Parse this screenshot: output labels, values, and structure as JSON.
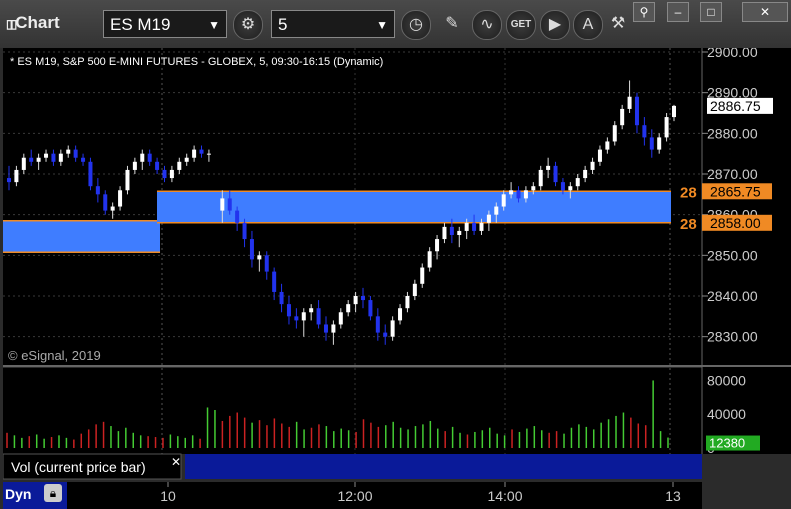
{
  "window": {
    "title": "Chart",
    "symbol": "ES M19",
    "interval": "5",
    "toolbar_icons": [
      "settings-icon",
      "clock-icon",
      "pencil-icon",
      "line-study-icon",
      "get-icon",
      "play-icon",
      "alert-icon",
      "tools-icon"
    ]
  },
  "chart_data": {
    "type": "candlestick",
    "title": "* ES M19, S&P 500 E-MINI FUTURES - GLOBEX, 5, 09:30-16:15 (Dynamic)",
    "watermark": "© eSignal, 2019",
    "x_tick_labels": [
      "10",
      "12:00",
      "14:00",
      "13"
    ],
    "price_axis": {
      "min": 2825,
      "max": 2900,
      "ticks": [
        2900,
        2890,
        2880,
        2870,
        2860,
        2850,
        2840,
        2830
      ],
      "tick_labels": [
        "2900.00",
        "2890.00",
        "2880.00",
        "2870.00",
        "2860.00",
        "2850.00",
        "2840.00",
        "2830.00"
      ]
    },
    "last_price": 2886.75,
    "last_price_label": "2886.75",
    "zones": [
      {
        "name": "prior-day-zone",
        "low": 2850.75,
        "high": 2858.5
      },
      {
        "name": "current-zone",
        "low": 2858.0,
        "high": 2865.75
      }
    ],
    "level_labels": [
      {
        "value": 2865.75,
        "label": "2865.75",
        "prefix": "28"
      },
      {
        "value": 2858.0,
        "label": "2858.00",
        "prefix": "28"
      }
    ],
    "candles": [
      [
        2869,
        2872,
        2866,
        2868
      ],
      [
        2868,
        2872,
        2867,
        2871
      ],
      [
        2871,
        2875,
        2870,
        2874
      ],
      [
        2874,
        2876,
        2872,
        2873
      ],
      [
        2873,
        2875,
        2871,
        2874
      ],
      [
        2874,
        2876,
        2873,
        2875
      ],
      [
        2875,
        2876,
        2872,
        2873
      ],
      [
        2873,
        2876,
        2872,
        2875
      ],
      [
        2875,
        2877,
        2874,
        2876
      ],
      [
        2876,
        2877,
        2873,
        2874
      ],
      [
        2874,
        2875,
        2872,
        2873
      ],
      [
        2873,
        2874,
        2866,
        2867
      ],
      [
        2867,
        2869,
        2863,
        2865
      ],
      [
        2865,
        2866,
        2860,
        2861
      ],
      [
        2861,
        2863,
        2859,
        2862
      ],
      [
        2862,
        2867,
        2861,
        2866
      ],
      [
        2866,
        2872,
        2865,
        2871
      ],
      [
        2871,
        2874,
        2870,
        2873
      ],
      [
        2873,
        2876,
        2871,
        2875
      ],
      [
        2875,
        2876,
        2872,
        2873
      ],
      [
        2873,
        2874,
        2870,
        2871
      ],
      [
        2871,
        2872,
        2868,
        2869
      ],
      [
        2869,
        2872,
        2868,
        2871
      ],
      [
        2871,
        2874,
        2870,
        2873
      ],
      [
        2873,
        2875,
        2872,
        2874
      ],
      [
        2874,
        2877,
        2873,
        2876
      ],
      [
        2876,
        2877,
        2874,
        2875
      ],
      [
        2875,
        2876,
        2873,
        2875
      ],
      [
        2861,
        2866,
        2858,
        2864
      ],
      [
        2864,
        2866,
        2860,
        2861
      ],
      [
        2861,
        2862,
        2856,
        2858
      ],
      [
        2858,
        2859,
        2852,
        2854
      ],
      [
        2854,
        2856,
        2847,
        2849
      ],
      [
        2849,
        2851,
        2846,
        2850
      ],
      [
        2850,
        2851,
        2844,
        2846
      ],
      [
        2846,
        2847,
        2839,
        2841
      ],
      [
        2841,
        2843,
        2836,
        2838
      ],
      [
        2838,
        2840,
        2833,
        2835
      ],
      [
        2835,
        2837,
        2832,
        2834
      ],
      [
        2834,
        2837,
        2830,
        2836
      ],
      [
        2836,
        2838,
        2834,
        2837
      ],
      [
        2837,
        2839,
        2832,
        2833
      ],
      [
        2833,
        2835,
        2829,
        2831
      ],
      [
        2831,
        2834,
        2828,
        2833
      ],
      [
        2833,
        2837,
        2832,
        2836
      ],
      [
        2836,
        2839,
        2835,
        2838
      ],
      [
        2838,
        2841,
        2836,
        2840
      ],
      [
        2840,
        2842,
        2837,
        2839
      ],
      [
        2839,
        2840,
        2834,
        2835
      ],
      [
        2835,
        2837,
        2829,
        2831
      ],
      [
        2831,
        2833,
        2828,
        2830
      ],
      [
        2830,
        2835,
        2829,
        2834
      ],
      [
        2834,
        2838,
        2833,
        2837
      ],
      [
        2837,
        2841,
        2836,
        2840
      ],
      [
        2840,
        2844,
        2839,
        2843
      ],
      [
        2843,
        2848,
        2842,
        2847
      ],
      [
        2847,
        2852,
        2846,
        2851
      ],
      [
        2851,
        2855,
        2849,
        2854
      ],
      [
        2854,
        2858,
        2853,
        2857
      ],
      [
        2857,
        2859,
        2853,
        2855
      ],
      [
        2855,
        2857,
        2852,
        2856
      ],
      [
        2856,
        2859,
        2854,
        2858
      ],
      [
        2858,
        2860,
        2855,
        2856
      ],
      [
        2856,
        2859,
        2855,
        2858
      ],
      [
        2858,
        2861,
        2856,
        2860
      ],
      [
        2860,
        2863,
        2858,
        2862
      ],
      [
        2862,
        2866,
        2861,
        2865
      ],
      [
        2865,
        2868,
        2864,
        2866
      ],
      [
        2866,
        2867,
        2863,
        2864
      ],
      [
        2864,
        2867,
        2863,
        2866
      ],
      [
        2866,
        2868,
        2865,
        2867
      ],
      [
        2867,
        2872,
        2866,
        2871
      ],
      [
        2871,
        2874,
        2869,
        2872
      ],
      [
        2872,
        2873,
        2867,
        2868
      ],
      [
        2868,
        2869,
        2865,
        2866
      ],
      [
        2866,
        2868,
        2864,
        2867
      ],
      [
        2867,
        2870,
        2866,
        2869
      ],
      [
        2869,
        2872,
        2868,
        2871
      ],
      [
        2871,
        2874,
        2870,
        2873
      ],
      [
        2873,
        2877,
        2872,
        2876
      ],
      [
        2876,
        2879,
        2875,
        2878
      ],
      [
        2878,
        2883,
        2877,
        2882
      ],
      [
        2882,
        2887,
        2881,
        2886
      ],
      [
        2886,
        2893,
        2885,
        2889
      ],
      [
        2889,
        2890,
        2880,
        2882
      ],
      [
        2882,
        2884,
        2877,
        2879
      ],
      [
        2879,
        2881,
        2874,
        2876
      ],
      [
        2876,
        2880,
        2875,
        2879
      ],
      [
        2879,
        2885,
        2878,
        2884
      ],
      [
        2884,
        2887,
        2883,
        2886.75
      ]
    ],
    "volume": {
      "axis_ticks": [
        80000,
        40000,
        0
      ],
      "axis_labels": [
        "80000",
        "40000",
        "0"
      ],
      "last_value_label": "12380",
      "values": [
        18000,
        15000,
        12000,
        14000,
        16000,
        11000,
        13000,
        15000,
        12000,
        10000,
        17000,
        22000,
        28000,
        31000,
        26000,
        20000,
        24000,
        18000,
        15000,
        14000,
        13000,
        12000,
        16000,
        14000,
        12000,
        15000,
        11000,
        48000,
        45000,
        32000,
        38000,
        42000,
        36000,
        30000,
        33000,
        27000,
        35000,
        29000,
        25000,
        31000,
        22000,
        24000,
        28000,
        26000,
        20000,
        23000,
        21000,
        19000,
        34000,
        30000,
        25000,
        27000,
        31000,
        24000,
        22000,
        26000,
        28000,
        32000,
        23000,
        20000,
        25000,
        18000,
        16000,
        19000,
        21000,
        24000,
        17000,
        15000,
        22000,
        19000,
        23000,
        26000,
        21000,
        18000,
        20000,
        17000,
        24000,
        28000,
        25000,
        22000,
        30000,
        34000,
        38000,
        42000,
        36000,
        29000,
        27000,
        80000,
        20000,
        12380
      ],
      "panel_label": "Vol (current price bar)"
    }
  },
  "footer": {
    "label": "Dyn"
  }
}
